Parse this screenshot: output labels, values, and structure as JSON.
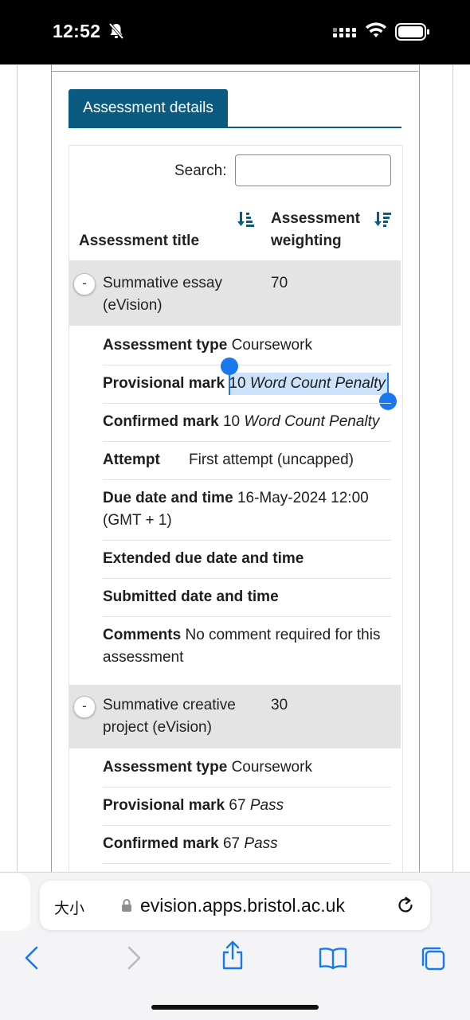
{
  "status_bar": {
    "time": "12:52"
  },
  "tab": {
    "label": "Assessment details"
  },
  "search": {
    "label": "Search:",
    "value": ""
  },
  "table": {
    "columns": [
      {
        "line1": "",
        "line2": "Assessment title"
      },
      {
        "line1": "Assessment",
        "line2": "weighting"
      }
    ],
    "rows": [
      {
        "toggle": "-",
        "title_line1": "Summative essay",
        "title_line2": "(eVision)",
        "weighting": "70",
        "details": {
          "assessment_type_label": "Assessment type",
          "assessment_type_value": "Coursework",
          "provisional_label": "Provisional mark",
          "provisional_mark": "10",
          "provisional_note": "Word Count Penalty",
          "confirmed_label": "Confirmed mark",
          "confirmed_mark": "10",
          "confirmed_note": "Word Count Penalty",
          "attempt_label": "Attempt",
          "attempt_value": "First attempt (uncapped)",
          "due_label": "Due date and time",
          "due_value_line1": "16-May-2024 12:00",
          "due_value_line2": "(GMT + 1)",
          "extended_label": "Extended due date and time",
          "submitted_label": "Submitted date and time",
          "comments_label": "Comments",
          "comments_value_line1": "No comment required for this",
          "comments_value_line2": "assessment"
        }
      },
      {
        "toggle": "-",
        "title_line1": "Summative creative",
        "title_line2": "project (eVision)",
        "weighting": "30",
        "details": {
          "assessment_type_label": "Assessment type",
          "assessment_type_value": "Coursework",
          "provisional_label": "Provisional mark",
          "provisional_mark": "67",
          "provisional_note": "Pass",
          "confirmed_label": "Confirmed mark",
          "confirmed_mark": "67",
          "confirmed_note": "Pass"
        }
      }
    ]
  },
  "browser": {
    "text_size_button": "大小",
    "url": "evision.apps.bristol.ac.uk",
    "icons": [
      "back-icon",
      "forward-icon",
      "share-icon",
      "bookmarks-icon",
      "tabs-icon",
      "reload-icon",
      "lock-icon"
    ]
  },
  "colors": {
    "accent": "#0b5a80",
    "selection": "#1878ee",
    "row_header_bg": "#e4e4e4"
  }
}
